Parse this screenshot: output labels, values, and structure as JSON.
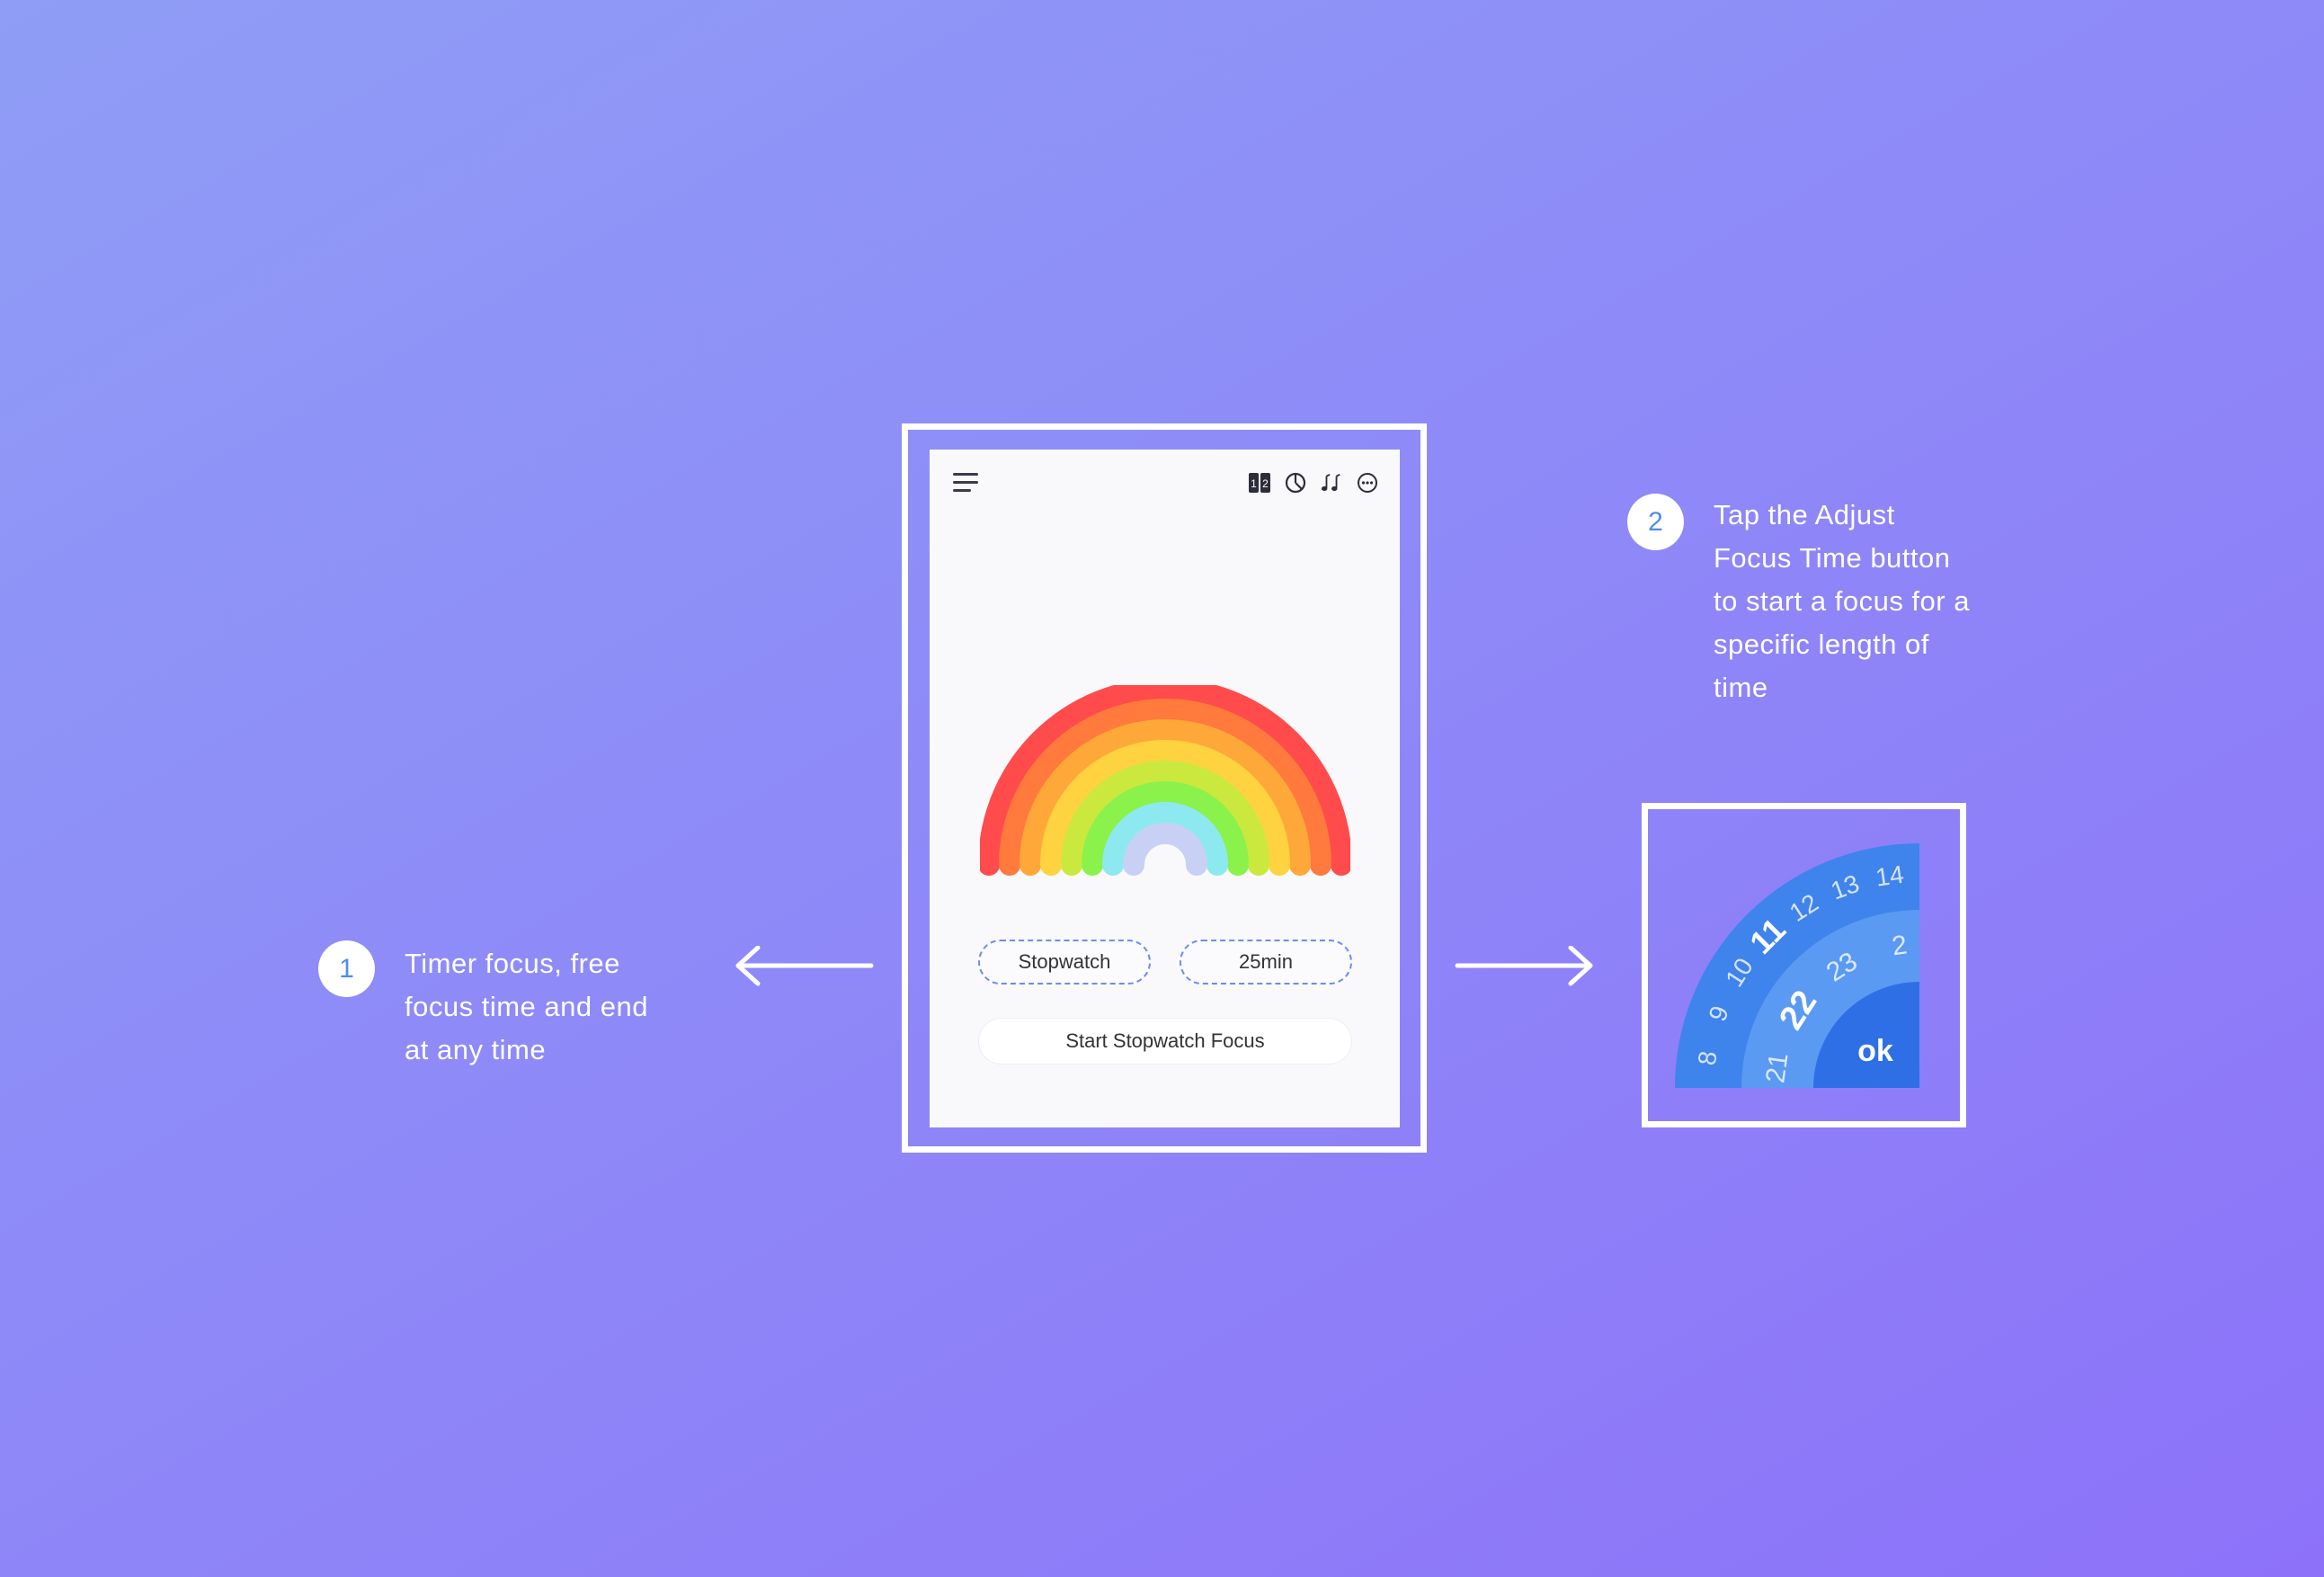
{
  "phone": {
    "header_icons": [
      "menu-icon",
      "flip-clock-icon",
      "pie-chart-icon",
      "music-icon",
      "more-icon"
    ],
    "stopwatch_label": "Stopwatch",
    "duration_label": "25min",
    "start_button": "Start Stopwatch Focus",
    "rainbow_colors": [
      "#ff4b4b",
      "#ff7a3c",
      "#ffa83a",
      "#ffd23f",
      "#cbe83f",
      "#8af24a",
      "#8de9f0",
      "#c8d1f5"
    ]
  },
  "step1": {
    "number": "1",
    "lines": [
      "Timer focus, free",
      "focus time and end",
      "at any time"
    ]
  },
  "step2": {
    "number": "2",
    "lines": [
      "Tap the Adjust",
      "Focus Time button",
      "to start a focus for a",
      "specific length of",
      "time"
    ]
  },
  "dial": {
    "outer_numbers": [
      "8",
      "9",
      "10",
      "11",
      "12",
      "13",
      "14"
    ],
    "inner_numbers": [
      "21",
      "22",
      "23",
      "2"
    ],
    "ok_label": "ok",
    "colors": {
      "outer": "#3f83ec",
      "inner": "#5a9af2",
      "center": "#2f6fe6"
    }
  },
  "colors": {
    "accent": "#4d8cf0",
    "frame": "#ffffff"
  }
}
